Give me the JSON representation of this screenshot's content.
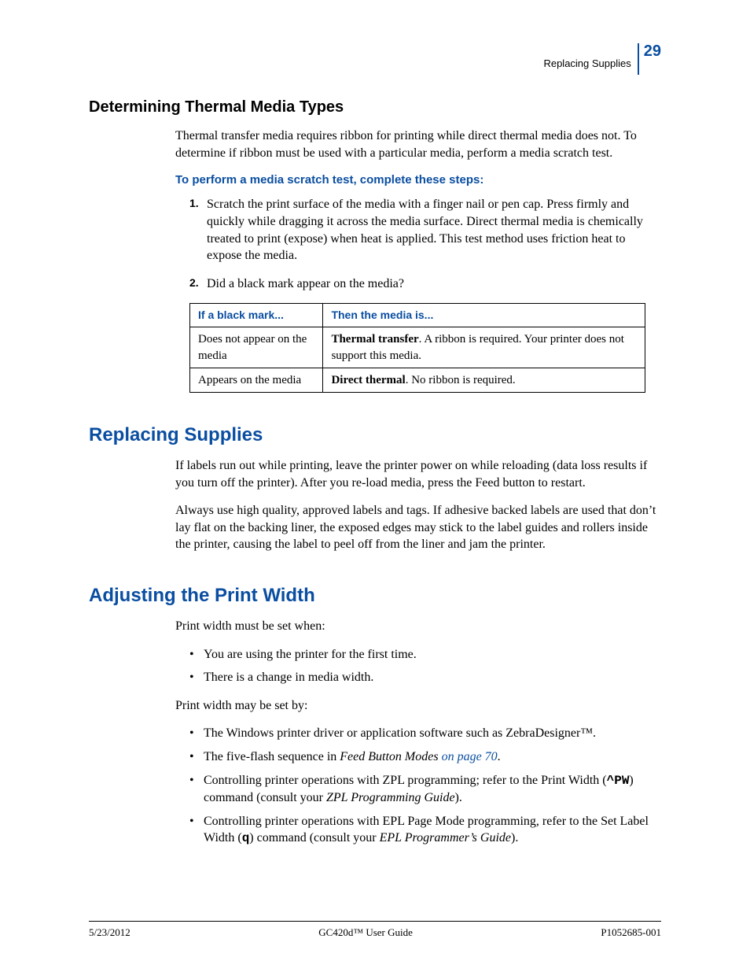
{
  "header": {
    "section_label": "Replacing Supplies",
    "page_number": "29"
  },
  "s1": {
    "title": "Determining Thermal Media Types",
    "intro": "Thermal transfer media requires ribbon for printing while direct thermal media does not. To determine if ribbon must be used with a particular media, perform a media scratch test.",
    "subhead": "To perform a media scratch test, complete these steps:",
    "step1_num": "1.",
    "step1": "Scratch the print surface of the media with a finger nail or pen cap. Press firmly and quickly while dragging it across the media surface. Direct thermal media is chemically treated to print (expose) when heat is applied. This test method uses friction heat to expose the media.",
    "step2_num": "2.",
    "step2": "Did a black mark appear on the media?",
    "table": {
      "h1": "If a black mark...",
      "h2": "Then the media is...",
      "r1c1": "Does not appear on the media",
      "r1c2_bold": "Thermal transfer",
      "r1c2_rest": ". A ribbon is required. Your printer does not support this media.",
      "r2c1": "Appears on the media",
      "r2c2_bold": "Direct thermal",
      "r2c2_rest": ". No ribbon is required."
    }
  },
  "s2": {
    "title": "Replacing Supplies",
    "p1": "If labels run out while printing, leave the printer power on while reloading (data loss results if you turn off the printer). After you re-load media, press the Feed button to restart.",
    "p2": "Always use high quality, approved labels and tags. If adhesive backed labels are used that don’t lay flat on the backing liner, the exposed edges may stick to the label guides and rollers inside the printer, causing the label to peel off from the liner and jam the printer."
  },
  "s3": {
    "title": "Adjusting the Print Width",
    "lead1": "Print width must be set when:",
    "b1": "You are using the printer for the first time.",
    "b2": "There is a change in media width.",
    "lead2": "Print width may be set by:",
    "c1": "The Windows printer driver or application software such as ZebraDesigner™.",
    "c2_a": "The five-flash sequence in ",
    "c2_b": "Feed Button Modes",
    "c2_c": " on page 70",
    "c2_d": ".",
    "c3_a": "Controlling printer operations with ZPL programming; refer to the Print Width (",
    "c3_cmd": "^PW",
    "c3_b": ") command (consult your ",
    "c3_c": "ZPL Programming Guide",
    "c3_d": ").",
    "c4_a": "Controlling printer operations with EPL Page Mode programming, refer to the Set Label Width (",
    "c4_cmd": "q",
    "c4_b": ") command (consult your ",
    "c4_c": "EPL Programmer’s Guide",
    "c4_d": ")."
  },
  "footer": {
    "left": "5/23/2012",
    "center": "GC420d™ User Guide",
    "right": "P1052685-001"
  }
}
